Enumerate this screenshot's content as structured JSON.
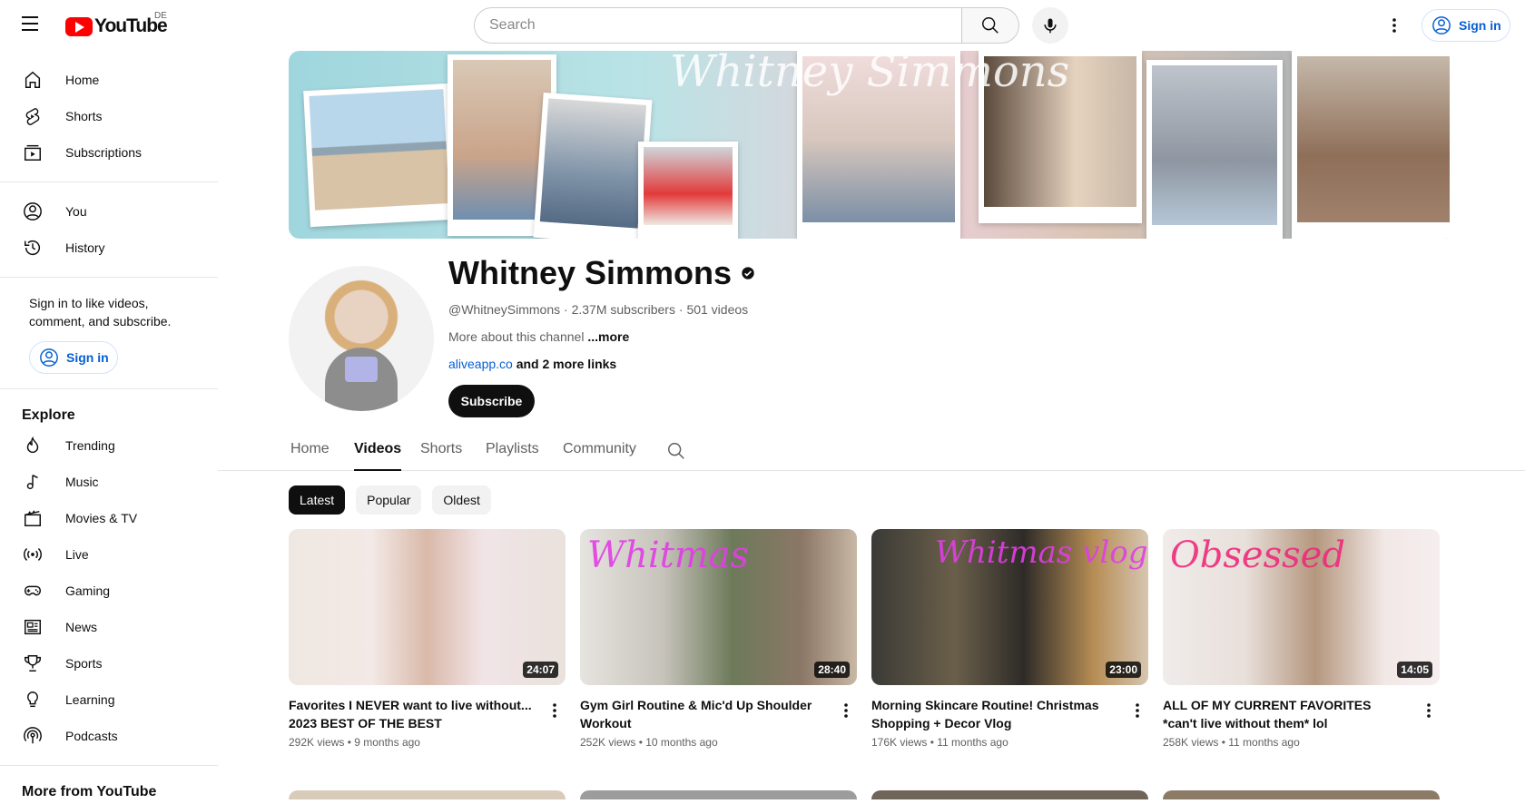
{
  "header": {
    "logo_text": "YouTube",
    "region": "DE",
    "search_placeholder": "Search",
    "signin_label": "Sign in"
  },
  "sidebar": {
    "main": [
      {
        "label": "Home",
        "icon": "home-icon"
      },
      {
        "label": "Shorts",
        "icon": "shorts-icon"
      },
      {
        "label": "Subscriptions",
        "icon": "subscriptions-icon"
      }
    ],
    "you": [
      {
        "label": "You",
        "icon": "you-icon"
      },
      {
        "label": "History",
        "icon": "history-icon"
      }
    ],
    "signin_text": "Sign in to like videos, comment, and subscribe.",
    "signin_label": "Sign in",
    "explore_heading": "Explore",
    "explore": [
      {
        "label": "Trending",
        "icon": "trending-icon"
      },
      {
        "label": "Music",
        "icon": "music-icon"
      },
      {
        "label": "Movies & TV",
        "icon": "movies-icon"
      },
      {
        "label": "Live",
        "icon": "live-icon"
      },
      {
        "label": "Gaming",
        "icon": "gaming-icon"
      },
      {
        "label": "News",
        "icon": "news-icon"
      },
      {
        "label": "Sports",
        "icon": "sports-icon"
      },
      {
        "label": "Learning",
        "icon": "learning-icon"
      },
      {
        "label": "Podcasts",
        "icon": "podcasts-icon"
      }
    ],
    "more_heading": "More from YouTube"
  },
  "banner": {
    "script_text": "Whitney Simmons"
  },
  "channel": {
    "name": "Whitney Simmons",
    "handle": "@WhitneySimmons",
    "subscribers": "2.37M subscribers",
    "videos": "501 videos",
    "about_text": "More about this channel",
    "about_more": "...more",
    "link": "aliveapp.co",
    "more_links": "and 2 more links",
    "subscribe_label": "Subscribe"
  },
  "tabs": [
    "Home",
    "Videos",
    "Shorts",
    "Playlists",
    "Community"
  ],
  "active_tab": "Videos",
  "chips": [
    "Latest",
    "Popular",
    "Oldest"
  ],
  "active_chip": "Latest",
  "videos": [
    {
      "title": "Favorites I NEVER want to live without... 2023 BEST OF THE BEST",
      "views": "292K views",
      "age": "9 months ago",
      "duration": "24:07",
      "overlay": ""
    },
    {
      "title": "Gym Girl Routine & Mic'd Up Shoulder Workout",
      "views": "252K views",
      "age": "10 months ago",
      "duration": "28:40",
      "overlay": "Whitmas"
    },
    {
      "title": "Morning Skincare Routine! Christmas Shopping + Decor Vlog",
      "views": "176K views",
      "age": "11 months ago",
      "duration": "23:00",
      "overlay": "Whitmas vlog"
    },
    {
      "title": "ALL OF MY CURRENT FAVORITES *can't live without them* lol",
      "views": "258K views",
      "age": "11 months ago",
      "duration": "14:05",
      "overlay": "Obsessed"
    }
  ],
  "colors": {
    "accent_blue": "#065fd4",
    "brand_red": "#ff0000",
    "text": "#0f0f0f",
    "muted": "#606060"
  }
}
